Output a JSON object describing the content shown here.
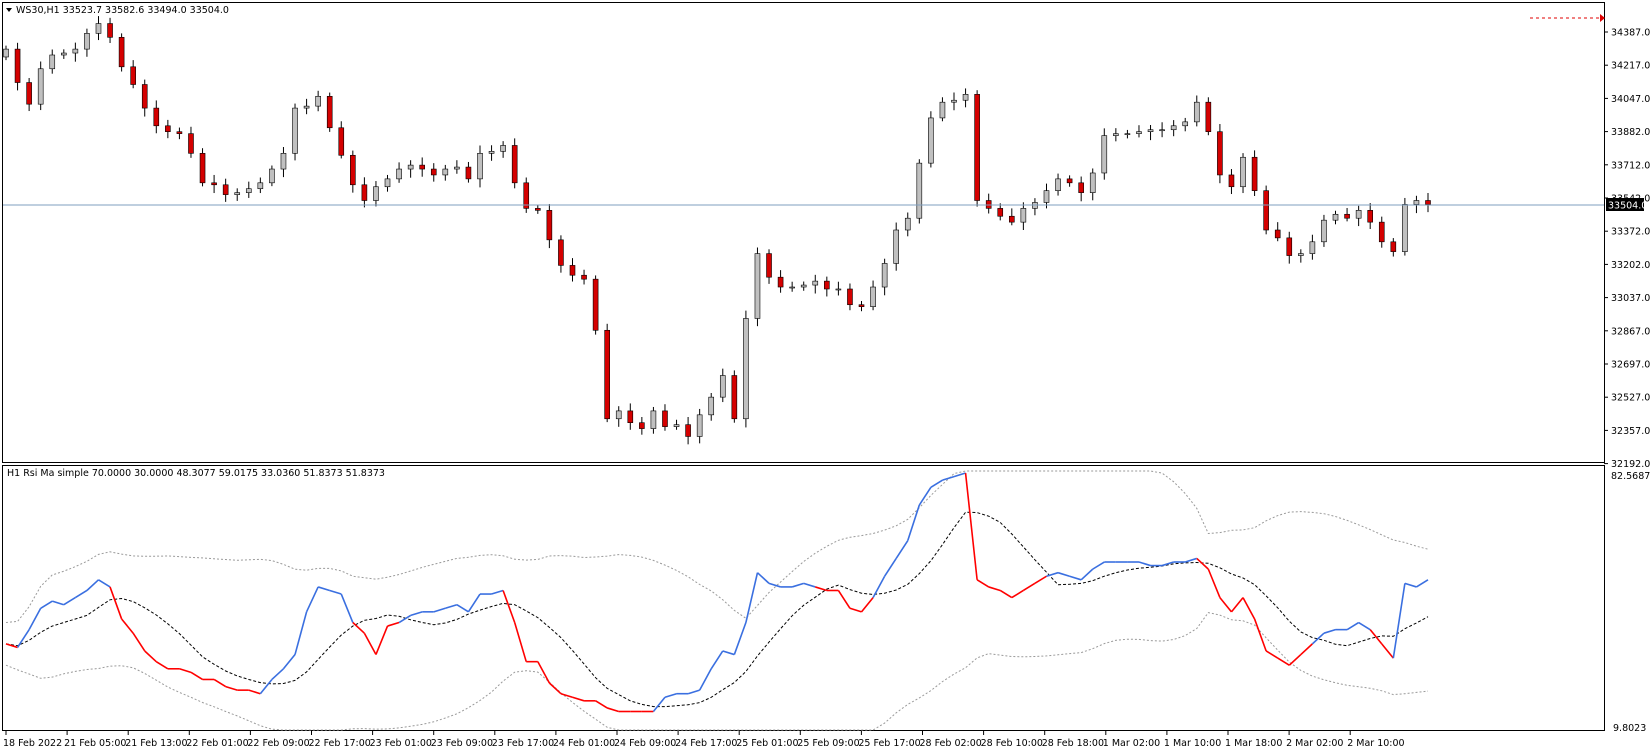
{
  "main_chart": {
    "title": "WS30,H1  33523.7 33582.6 33494.0 33504.0",
    "price_axis": [
      "34387.0",
      "34217.0",
      "34047.0",
      "33882.0",
      "33712.0",
      "33542.0",
      "33372.0",
      "33202.0",
      "33037.0",
      "32867.0",
      "32697.0",
      "32527.0",
      "32357.0",
      "32192.0"
    ],
    "current_price_label": "33504.0",
    "colors": {
      "bull_candle": "#c0c0c0",
      "bear_candle": "#d40000",
      "wick": "#000000",
      "price_line": "#7f9fbf"
    }
  },
  "indicator": {
    "title": "H1 Rsi Ma simple 70.0000 30.0000 48.3077 59.0175 33.0360 51.8373 51.8373",
    "axis_max": "82.5687",
    "axis_min": "9.8023",
    "colors": {
      "rsi_up": "#3a6fe0",
      "rsi_down": "#ff0000",
      "ma": "#000000",
      "bands": "#9a9a9a"
    }
  },
  "time_axis": [
    "18 Feb 2022",
    "21 Feb 05:00",
    "21 Feb 13:00",
    "22 Feb 01:00",
    "22 Feb 09:00",
    "22 Feb 17:00",
    "23 Feb 01:00",
    "23 Feb 09:00",
    "23 Feb 17:00",
    "24 Feb 01:00",
    "24 Feb 09:00",
    "24 Feb 17:00",
    "25 Feb 01:00",
    "25 Feb 09:00",
    "25 Feb 17:00",
    "28 Feb 02:00",
    "28 Feb 10:00",
    "28 Feb 18:00",
    "1 Mar 02:00",
    "1 Mar 10:00",
    "1 Mar 18:00",
    "2 Mar 02:00",
    "2 Mar 10:00"
  ],
  "chart_data": {
    "type": "candlestick",
    "symbol": "WS30",
    "timeframe": "H1",
    "series_close": [
      34300,
      34130,
      34020,
      34200,
      34270,
      34280,
      34300,
      34380,
      34430,
      34360,
      34210,
      34120,
      34000,
      33910,
      33880,
      33870,
      33770,
      33620,
      33610,
      33560,
      33570,
      33590,
      33620,
      33690,
      33770,
      34000,
      34010,
      34060,
      33900,
      33760,
      33610,
      33530,
      33600,
      33640,
      33690,
      33710,
      33690,
      33660,
      33690,
      33700,
      33640,
      33770,
      33780,
      33810,
      33620,
      33490,
      33480,
      33330,
      33200,
      33150,
      33130,
      32870,
      32420,
      32460,
      32400,
      32370,
      32460,
      32380,
      32390,
      32330,
      32440,
      32530,
      32640,
      32420,
      32930,
      33260,
      33140,
      33090,
      33090,
      33100,
      33120,
      33080,
      33080,
      33000,
      32990,
      33090,
      33210,
      33380,
      33440,
      33720,
      33950,
      34030,
      34040,
      34070,
      33530,
      33490,
      33450,
      33420,
      33490,
      33520,
      33580,
      33640,
      33620,
      33570,
      33670,
      33860,
      33870,
      33870,
      33880,
      33890,
      33890,
      33910,
      33930,
      34030,
      33880,
      33660,
      33600,
      33750,
      33580,
      33380,
      33340,
      33250,
      33260,
      33320,
      33430,
      33460,
      33440,
      33480,
      33420,
      33320,
      33270,
      33510,
      33530,
      33510
    ],
    "rsi": [
      34,
      33,
      38,
      44,
      46,
      45,
      47,
      49,
      52,
      50,
      41,
      37,
      32,
      29,
      27,
      27,
      26,
      24,
      24,
      22,
      21,
      21,
      20,
      24,
      27,
      31,
      43,
      50,
      49,
      48,
      40,
      37,
      31,
      39,
      40,
      42,
      43,
      43,
      44,
      45,
      43,
      48,
      48,
      49,
      40,
      29,
      29,
      23,
      20,
      19,
      18,
      18,
      16,
      15,
      15,
      15,
      15,
      19,
      20,
      20,
      21,
      27,
      32,
      31,
      40,
      54,
      51,
      50,
      50,
      51,
      50,
      49,
      49,
      44,
      43,
      47,
      53,
      58,
      63,
      73,
      78,
      80,
      81,
      82,
      52,
      50,
      49,
      47,
      49,
      51,
      53,
      54,
      53,
      52,
      55,
      57,
      57,
      57,
      57,
      56,
      56,
      57,
      57,
      58,
      55,
      47,
      43,
      47,
      41,
      32,
      30,
      28,
      31,
      34,
      37,
      38,
      38,
      40,
      38,
      34,
      30,
      51,
      50,
      52
    ]
  }
}
